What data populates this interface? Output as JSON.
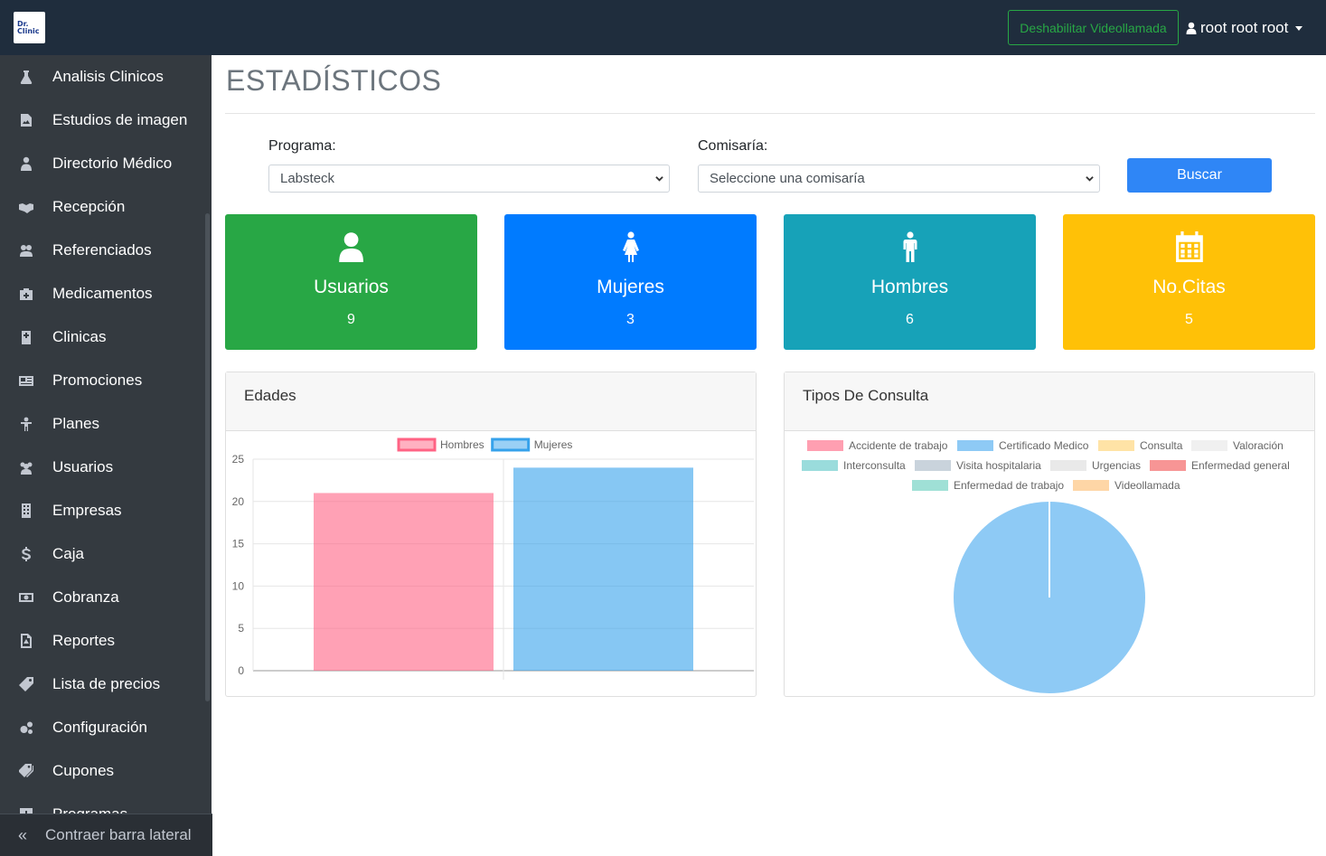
{
  "brand": {
    "logo_line1": "Dr.",
    "logo_line2": "Clinic"
  },
  "header": {
    "video_button": "Deshabilitar Videollamada",
    "user_name": "root root root"
  },
  "sidebar": {
    "items": [
      {
        "label": "Analisis Clinicos",
        "icon": "flask-icon"
      },
      {
        "label": "Estudios de imagen",
        "icon": "image-file-icon"
      },
      {
        "label": "Directorio Médico",
        "icon": "doctor-icon"
      },
      {
        "label": "Recepción",
        "icon": "handshake-icon"
      },
      {
        "label": "Referenciados",
        "icon": "referral-icon"
      },
      {
        "label": "Medicamentos",
        "icon": "medkit-icon"
      },
      {
        "label": "Clinicas",
        "icon": "hospital-icon"
      },
      {
        "label": "Promociones",
        "icon": "newspaper-icon"
      },
      {
        "label": "Planes",
        "icon": "person-arms-icon"
      },
      {
        "label": "Usuarios",
        "icon": "users-icon"
      },
      {
        "label": "Empresas",
        "icon": "building-icon"
      },
      {
        "label": "Caja",
        "icon": "dollar-icon"
      },
      {
        "label": "Cobranza",
        "icon": "money-bill-icon"
      },
      {
        "label": "Reportes",
        "icon": "pdf-file-icon"
      },
      {
        "label": "Lista de precios",
        "icon": "tag-icon"
      },
      {
        "label": "Configuración",
        "icon": "cogs-icon"
      },
      {
        "label": "Cupones",
        "icon": "tags-icon"
      },
      {
        "label": "Programas",
        "icon": "plus-square-icon"
      }
    ],
    "collapse_label": "Contraer barra lateral"
  },
  "page": {
    "title": "ESTADÍSTICOS",
    "programa_label": "Programa:",
    "programa_value": "Labsteck",
    "comisaria_label": "Comisaría:",
    "comisaria_value": "Seleccione una comisaría",
    "search_button": "Buscar"
  },
  "cards": [
    {
      "title": "Usuarios",
      "value": "9",
      "color": "#28a745",
      "icon": "user-icon"
    },
    {
      "title": "Mujeres",
      "value": "3",
      "color": "#007bff",
      "icon": "female-icon"
    },
    {
      "title": "Hombres",
      "value": "6",
      "color": "#17a2b8",
      "icon": "male-icon"
    },
    {
      "title": "No.Citas",
      "value": "5",
      "color": "#ffc107",
      "icon": "calendar-icon"
    }
  ],
  "panels": {
    "edades_title": "Edades",
    "tipos_title": "Tipos De Consulta"
  },
  "chart_data": [
    {
      "type": "bar",
      "title": "Edades",
      "categories": [
        ""
      ],
      "series": [
        {
          "name": "Hombres",
          "values": [
            21
          ],
          "color": "#ff6384"
        },
        {
          "name": "Mujeres",
          "values": [
            24
          ],
          "color": "#36a2eb"
        }
      ],
      "ylim": [
        0,
        25
      ],
      "yticks": [
        "0",
        "5",
        "10",
        "15",
        "20",
        "25"
      ],
      "grid": true,
      "legend": "top"
    },
    {
      "type": "pie",
      "title": "Tipos De Consulta",
      "labels": [
        "Accidente de trabajo",
        "Certificado Medico",
        "Consulta",
        "Valoración",
        "Interconsulta",
        "Visita hospitalaria",
        "Urgencias",
        "Enfermedad general",
        "Enfermedad de trabajo",
        "Videollamada"
      ],
      "colors": [
        "#ff9fb1",
        "#8ecaf5",
        "#ffe3a6",
        "#f0f0f0",
        "#9adcdc",
        "#c9d3dc",
        "#e9e9e9",
        "#f79595",
        "#9fe0d6",
        "#fed6a6"
      ],
      "values": [
        0,
        100,
        0,
        0,
        0,
        0,
        0,
        0,
        0,
        0
      ],
      "legend": "top"
    }
  ]
}
